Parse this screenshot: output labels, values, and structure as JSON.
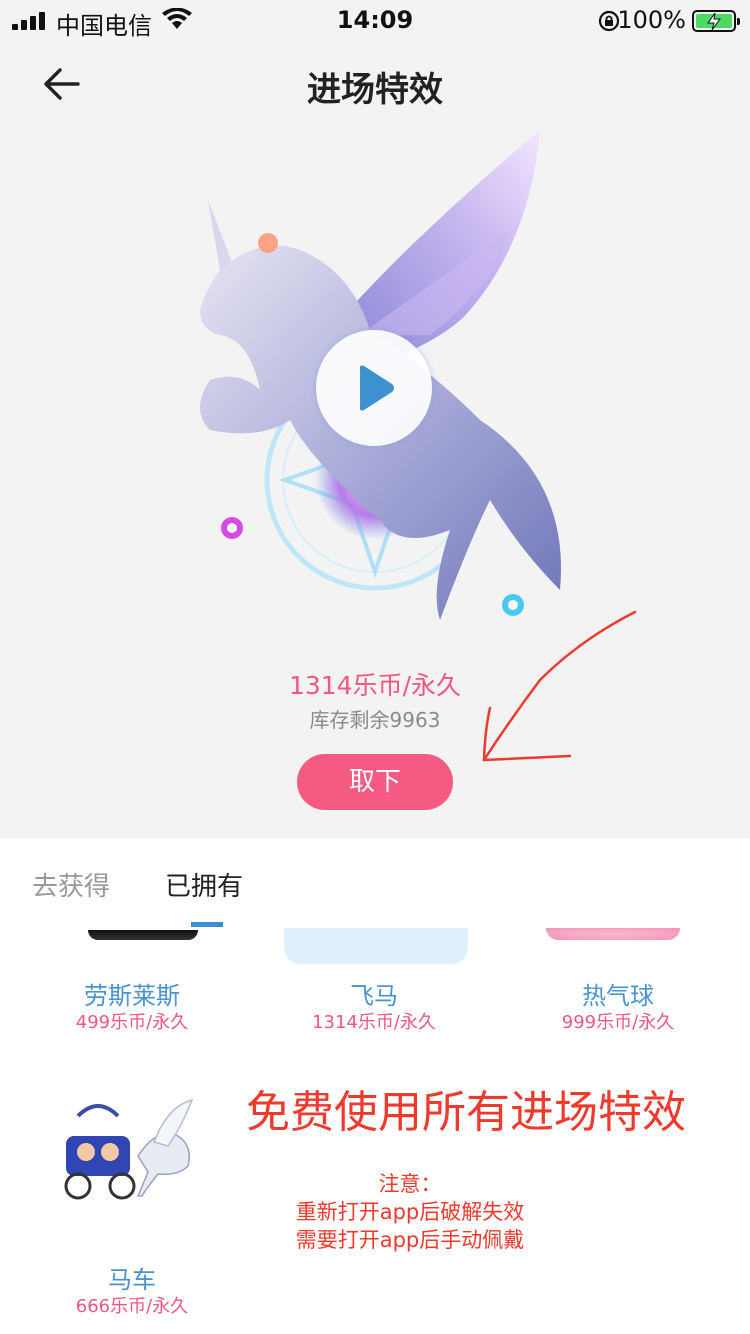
{
  "status_bar": {
    "carrier": "中国电信",
    "time": "14:09",
    "battery": "100%"
  },
  "header": {
    "title": "进场特效"
  },
  "effect": {
    "price": "1314乐币/永久",
    "stock": "库存剩余9963",
    "remove_label": "取下"
  },
  "tabs": [
    {
      "label": "去获得"
    },
    {
      "label": "已拥有"
    }
  ],
  "items": [
    {
      "name": "劳斯莱斯",
      "price": "499乐币/永久"
    },
    {
      "name": "飞马",
      "price": "1314乐币/永久"
    },
    {
      "name": "热气球",
      "price": "999乐币/永久"
    },
    {
      "name": "马车",
      "price": "666乐币/永久"
    }
  ],
  "annotation": {
    "promo": "免费使用所有进场特效",
    "note_title": "注意：",
    "note_line1": "重新打开app后破解失效",
    "note_line2": "需要打开app后手动佩戴"
  }
}
